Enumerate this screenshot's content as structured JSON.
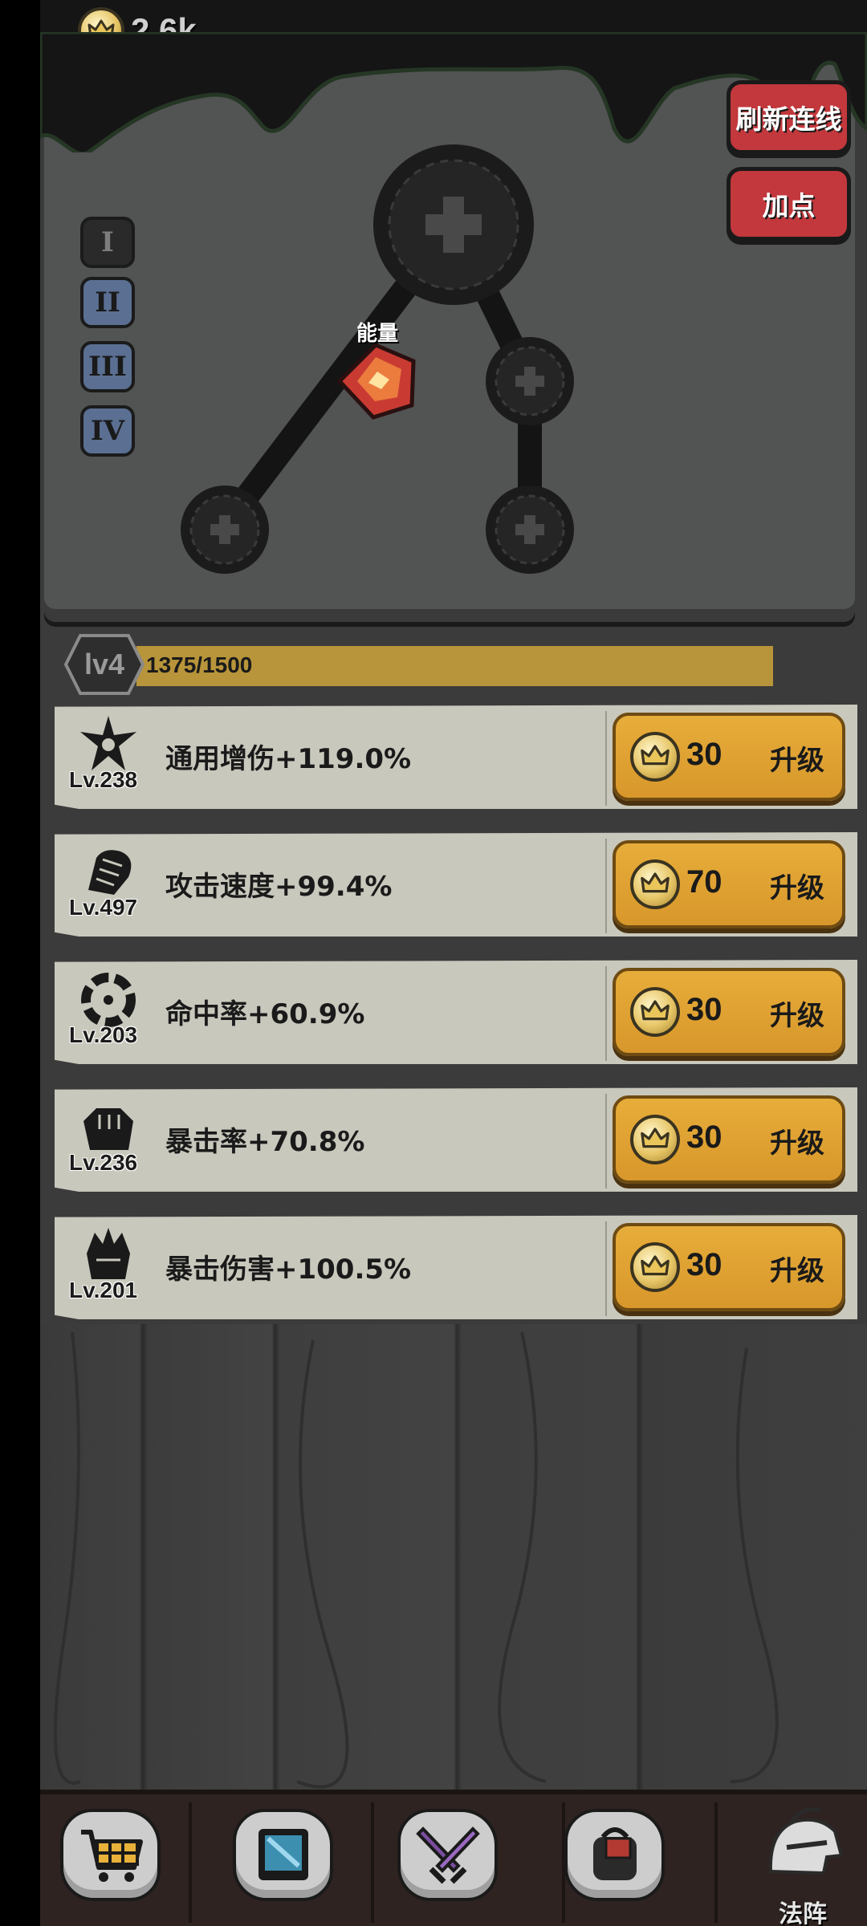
{
  "currency": {
    "value": "2.6k",
    "icon": "crown-coin-icon"
  },
  "top_buttons": {
    "refresh": "刷新连线",
    "add_point": "加点"
  },
  "tier_tabs": [
    "I",
    "II",
    "III",
    "IV"
  ],
  "tree": {
    "gem_label": "能量",
    "node_icon": "plus-icon"
  },
  "level": {
    "label": "lv4",
    "progress_text": "1375/1500",
    "current": 1375,
    "max": 1500
  },
  "upgrades": [
    {
      "level": "Lv.238",
      "stat": "通用增伤+119.0%",
      "cost": "30",
      "button": "升级"
    },
    {
      "level": "Lv.497",
      "stat": "攻击速度+99.4%",
      "cost": "70",
      "button": "升级"
    },
    {
      "level": "Lv.203",
      "stat": "命中率+60.9%",
      "cost": "30",
      "button": "升级"
    },
    {
      "level": "Lv.236",
      "stat": "暴击率+70.8%",
      "cost": "30",
      "button": "升级"
    },
    {
      "level": "Lv.201",
      "stat": "暴击伤害+100.5%",
      "cost": "30",
      "button": "升级"
    }
  ],
  "nav": {
    "active_label": "法阵",
    "items": [
      "shop-cart-icon",
      "skill-book-icon",
      "crossed-swords-icon",
      "backpack-icon",
      "helmet-icon"
    ]
  },
  "colors": {
    "accent_red": "#c2383c",
    "upgrade_orange": "#e2a535",
    "level_fill": "#b8953a",
    "tab_blue": "#5a6f92"
  }
}
